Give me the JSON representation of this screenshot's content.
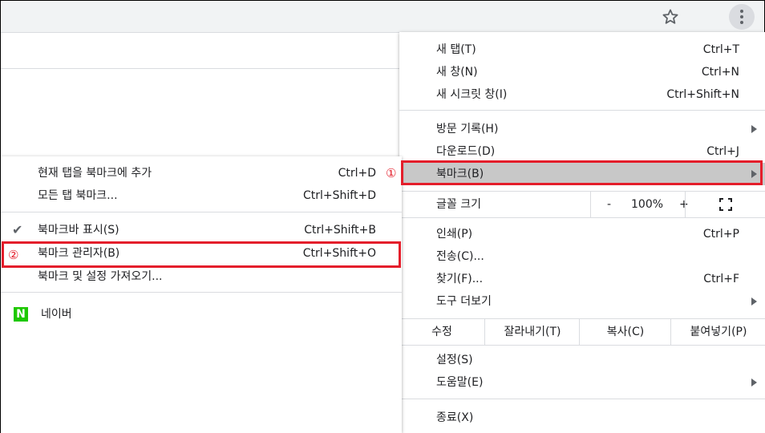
{
  "toolbar": {
    "star_icon": "star-outline-icon",
    "menu_icon": "three-dots-vertical-icon"
  },
  "main_menu": {
    "new_tab": {
      "label": "새 탭(T)",
      "shortcut": "Ctrl+T"
    },
    "new_window": {
      "label": "새 창(N)",
      "shortcut": "Ctrl+N"
    },
    "incognito": {
      "label": "새 시크릿 창(I)",
      "shortcut": "Ctrl+Shift+N"
    },
    "history": {
      "label": "방문 기록(H)"
    },
    "downloads": {
      "label": "다운로드(D)",
      "shortcut": "Ctrl+J"
    },
    "bookmarks": {
      "label": "북마크(B)"
    },
    "zoom": {
      "label": "글꼴 크기",
      "minus": "-",
      "value": "100%",
      "plus": "+",
      "fullscreen_icon": "fullscreen-icon"
    },
    "print": {
      "label": "인쇄(P)",
      "shortcut": "Ctrl+P"
    },
    "cast": {
      "label": "전송(C)..."
    },
    "find": {
      "label": "찾기(F)...",
      "shortcut": "Ctrl+F"
    },
    "more_tools": {
      "label": "도구 더보기"
    },
    "edit": {
      "label": "수정",
      "cut": "잘라내기(T)",
      "copy": "복사(C)",
      "paste": "붙여넣기(P)"
    },
    "settings": {
      "label": "설정(S)"
    },
    "help": {
      "label": "도움말(E)"
    },
    "exit": {
      "label": "종료(X)"
    }
  },
  "sub_menu": {
    "bookmark_tab": {
      "label": "현재 탭을 북마크에 추가",
      "shortcut": "Ctrl+D"
    },
    "bookmark_all": {
      "label": "모든 탭 북마크...",
      "shortcut": "Ctrl+Shift+D"
    },
    "show_bar": {
      "label": "북마크바 표시(S)",
      "shortcut": "Ctrl+Shift+B",
      "checked": true
    },
    "manager": {
      "label": "북마크 관리자(B)",
      "shortcut": "Ctrl+Shift+O"
    },
    "import": {
      "label": "북마크 및 설정 가져오기..."
    },
    "naver": {
      "label": "네이버",
      "icon": "N"
    }
  },
  "annotations": {
    "step1": "①",
    "step2": "②",
    "color": "#e41e2b"
  }
}
